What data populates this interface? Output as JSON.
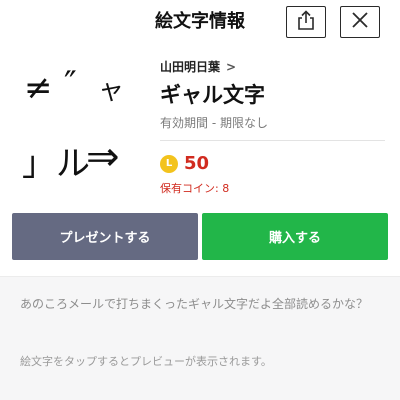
{
  "header": {
    "title": "絵文字情報"
  },
  "icons": {
    "share": "share-icon",
    "close": "close-icon",
    "coin": "coin-icon"
  },
  "preview": {
    "glyphs": [
      "≠",
      "″",
      "ャ",
      "」ル",
      "⇒"
    ]
  },
  "product": {
    "author": "山田明日葉",
    "author_chevron": ">",
    "name": "ギャル文字",
    "validity": "有効期間 - 期限なし",
    "coin_letter": "L",
    "price": "50",
    "owned_coins": "保有コイン: 8"
  },
  "actions": {
    "present_label": "プレゼントする",
    "buy_label": "購入する"
  },
  "description": {
    "text": "あのころメールで打ちまくったギャル文字だよ全部読めるかな？",
    "hint": "絵文字をタップするとプレビューが表示されます。"
  },
  "colors": {
    "buy": "#22b649",
    "present": "#656a82",
    "price": "#d12b1f",
    "coin": "#f3c31d"
  }
}
